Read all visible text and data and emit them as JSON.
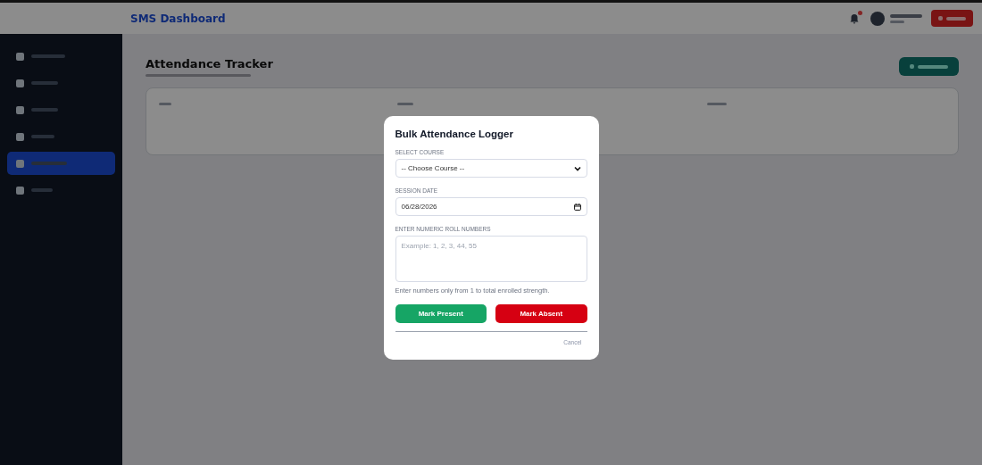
{
  "header": {
    "brand": "SMS Dashboard",
    "notification_dot": true
  },
  "sidebar": {
    "items": [
      {
        "selected": false
      },
      {
        "selected": false
      },
      {
        "selected": false
      },
      {
        "selected": false
      },
      {
        "selected": true
      },
      {
        "selected": false
      }
    ]
  },
  "page": {
    "title": "Attendance Tracker"
  },
  "modal": {
    "title": "Bulk Attendance Logger",
    "course_label": "SELECT COURSE",
    "course_value": "-- Choose Course --",
    "date_label": "SESSION DATE",
    "date_value": "06/28/2026",
    "roll_label": "ENTER NUMERIC ROLL NUMBERS",
    "roll_placeholder": "Example: 1, 2, 3, 44, 55",
    "hint": "Enter numbers only from 1 to total enrolled strength.",
    "present_button": "Mark Present",
    "absent_button": "Mark Absent",
    "cancel": "Cancel"
  }
}
